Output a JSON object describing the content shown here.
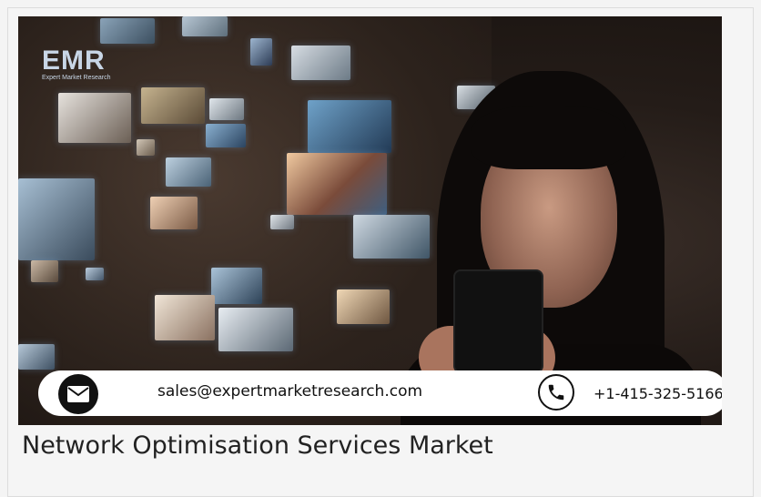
{
  "hero": {
    "logo_text": "EMR",
    "logo_subtext": "Expert Market Research",
    "email": "sales@expertmarketresearch.com",
    "phone": "+1-415-325-5166",
    "icons": {
      "email": "mail-icon",
      "phone": "phone-icon"
    }
  },
  "caption": {
    "title": "Network Optimisation Services Market"
  },
  "colors": {
    "background": "#f4f4f4",
    "bar": "#ffffff",
    "text": "#111111",
    "caption": "#222222"
  }
}
